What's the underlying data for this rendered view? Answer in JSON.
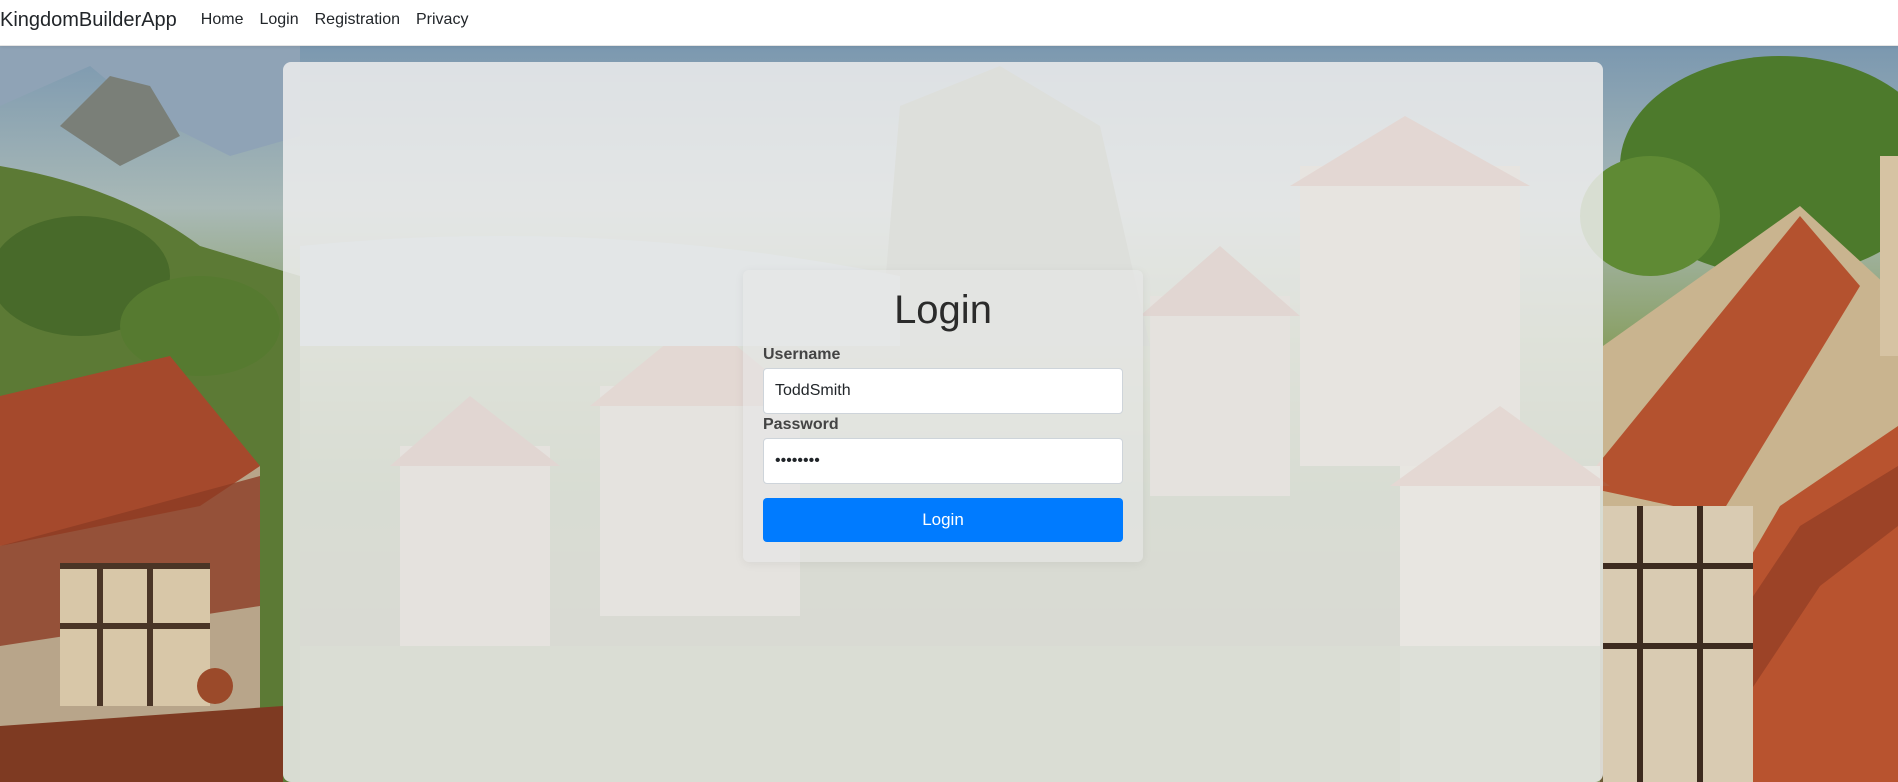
{
  "navbar": {
    "brand": "KingdomBuilderApp",
    "links": [
      {
        "label": "Home"
      },
      {
        "label": "Login"
      },
      {
        "label": "Registration"
      },
      {
        "label": "Privacy"
      }
    ]
  },
  "login": {
    "title": "Login",
    "username_label": "Username",
    "username_value": "ToddSmith",
    "password_label": "Password",
    "password_value": "password",
    "button_label": "Login"
  },
  "colors": {
    "primary": "#007bff",
    "panel": "#ececec"
  }
}
